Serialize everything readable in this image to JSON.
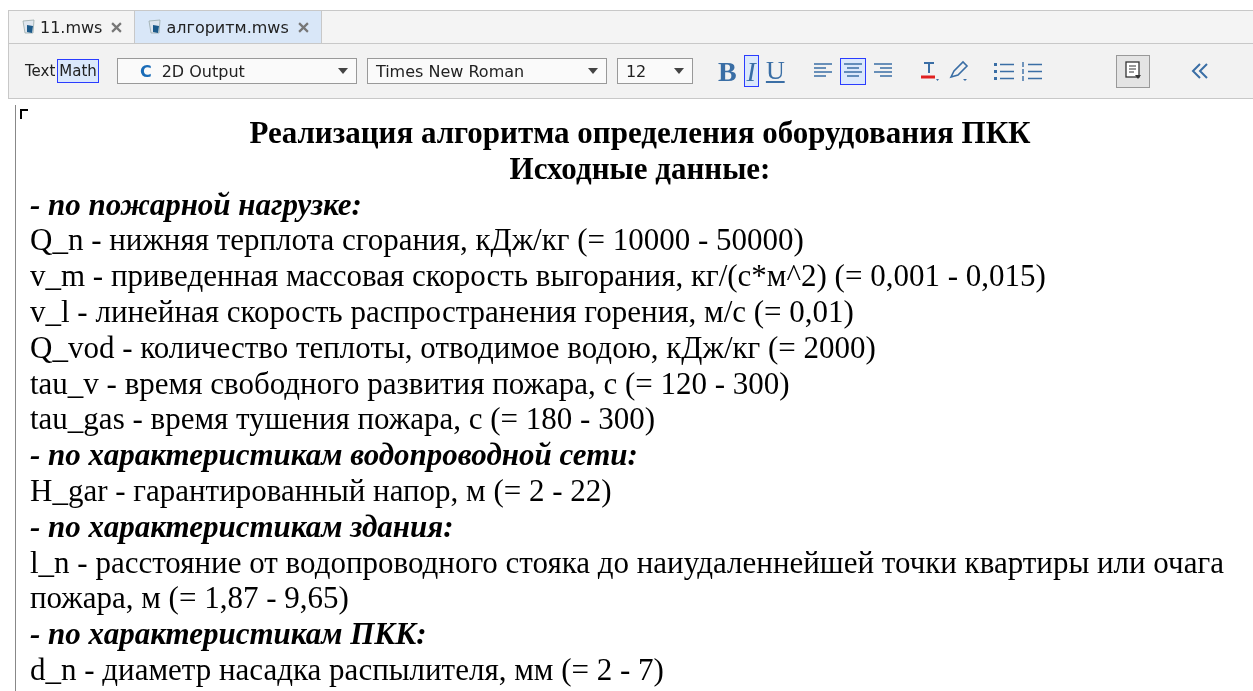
{
  "tabs": [
    {
      "label": "11.mws",
      "selected": false
    },
    {
      "label": "алгоритм.mws",
      "selected": true
    }
  ],
  "toolbar": {
    "modes": [
      {
        "label": "Text",
        "selected": false
      },
      {
        "label": "Math",
        "selected": true
      }
    ],
    "style_dropdown": {
      "icon_letter": "C",
      "value": "2D Output"
    },
    "font_dropdown": {
      "value": "Times New Roman"
    },
    "size_dropdown": {
      "value": "12"
    },
    "format": [
      {
        "kind": "bold",
        "label": "B",
        "selected": false
      },
      {
        "kind": "italic",
        "label": "I",
        "selected": true
      },
      {
        "kind": "underline",
        "label": "U",
        "selected": false
      }
    ],
    "align": [
      {
        "kind": "left",
        "selected": false
      },
      {
        "kind": "center",
        "selected": true
      },
      {
        "kind": "right",
        "selected": false
      }
    ]
  },
  "document": [
    {
      "kind": "heading",
      "text": "Реализация алгоритма определения оборудования ПКК"
    },
    {
      "kind": "heading",
      "text": "Исходные данные:"
    },
    {
      "kind": "section",
      "text": "- по пожарной нагрузке:"
    },
    {
      "kind": "text",
      "text": "Q_n - нижняя терплота сгорания, кДж/кг (= 10000 - 50000)"
    },
    {
      "kind": "text",
      "text": "v_m - приведенная массовая скорость выгорания, кг/(с*м^2) (= 0,001 - 0,015)"
    },
    {
      "kind": "text",
      "text": "v_l - линейная скорость распространения горения, м/с (= 0,01)"
    },
    {
      "kind": "text",
      "text": "Q_vod - количество теплоты, отводимое водою, кДж/кг (= 2000)"
    },
    {
      "kind": "text",
      "text": "tau_v - время свободного развития пожара, с (= 120 - 300)"
    },
    {
      "kind": "text",
      "text": "tau_gas - время тушения пожара, с (= 180 - 300)"
    },
    {
      "kind": "section",
      "text": "- по характеристикам водопроводной сети:"
    },
    {
      "kind": "text",
      "text": "H_gar - гарантированный напор, м (= 2 - 22)"
    },
    {
      "kind": "section",
      "text": "- по характеристикам здания:"
    },
    {
      "kind": "text",
      "text": "l_n - расстояние от водопроводного стояка до наиудаленнейшей точки квартиры или очага пожара, м (= 1,87 - 9,65)"
    },
    {
      "kind": "section",
      "text": "- по характеристикам ПКК:"
    },
    {
      "kind": "text",
      "text": "d_n - диаметр насадка распылителя, мм (= 2 - 7)"
    }
  ]
}
